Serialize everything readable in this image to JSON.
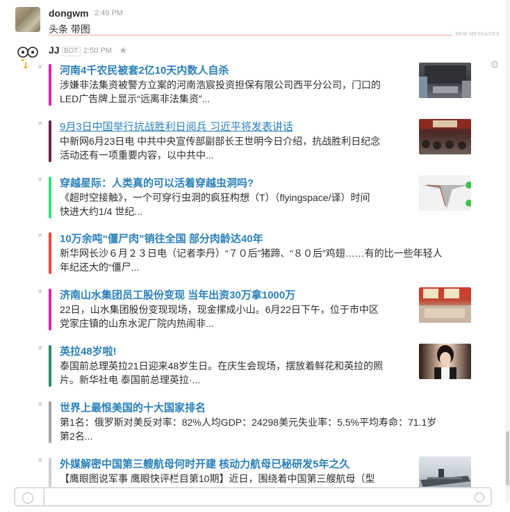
{
  "message1": {
    "username": "dongwm",
    "time": "2:49 PM",
    "text": "头条 带图"
  },
  "divider": {
    "label": "NEW MESSAGES"
  },
  "message2": {
    "username": "JJ",
    "badge": "BOT",
    "time": "2:50 PM"
  },
  "attachments": [
    {
      "title": "河南4千农民被套2亿10天内数人自杀",
      "desc_line1": "涉嫌非法集资被警方立案的河南浩宸投资担保有限公司西平分公司，门口的",
      "desc_line2": "LED广告牌上显示“远离非法集资”...",
      "bar_color": "#e01fb4",
      "has_thumb": true
    },
    {
      "title": "9月3日中国举行抗战胜利日阅兵 习近平将发表讲话",
      "desc_line1": "中新网6月23日电 中共中央宣传部副部长王世明今日介绍，抗战胜利日纪念",
      "desc_line2": "活动还有一项重要内容，以中共中...",
      "bar_color": "#6b2149",
      "has_thumb": true
    },
    {
      "title": "穿越星际：人类真的可以活着穿越虫洞吗?",
      "desc_line1": "《超时空接触》，一个可穿行虫洞的疯狂构想（T）（flyingspace/译）时间",
      "desc_line2": "快进大约1/4 世纪...",
      "bar_color": "#2ee57e",
      "has_thumb": true
    },
    {
      "title": "10万余吨“僵尸肉”销往全国 部分肉龄达40年",
      "desc_line1": "新华网长沙６月２３日电（记者李丹）“７０后”猪蹄、“８０后”鸡翅……有的比一些年轻人",
      "desc_line2": "年纪还大的“僵尸...",
      "bar_color": "#f5443a",
      "has_thumb": false
    },
    {
      "title": "济南山水集团员工股份变现 当年出资30万拿1000万",
      "desc_line1": "22日，山水集团股份变现现场，现金摞成小山。6月22日下午，位于市中区",
      "desc_line2": "党家庄镇的山东水泥厂院内热闹非...",
      "bar_color": "#e01fb4",
      "has_thumb": true
    },
    {
      "title": "英拉48岁啦!",
      "desc_line1": "泰国前总理英拉21日迎来48岁生日。在庆生会现场，摆放着鲜花和英拉的照",
      "desc_line2": "片。新华社电 泰国前总理英拉·...",
      "bar_color": "#2c8b6b",
      "has_thumb": true
    },
    {
      "title": "世界上最恨美国的十大国家排名",
      "desc_line1": "第1名：俄罗斯对美反对率：82%人均GDP：24298美元失业率：5.5%平均寿命：71.1岁",
      "desc_line2": "第2名...",
      "bar_color": "#a3a3a3",
      "has_thumb": false
    },
    {
      "title": "外媒解密中国第三艘航母何时开建 核动力航母已秘研发5年之久",
      "desc_line1": "【鹰眼图说军事  鹰眼快评栏目第10期】近日，围绕着中国第三艘航母（型",
      "desc_line2": "",
      "bar_color": "#cfcfd2",
      "has_thumb": true
    }
  ],
  "icons": {
    "close": "close-icon",
    "star": "star-icon",
    "gear": "gear-icon",
    "plus": "plus-icon",
    "emoji": "emoji-icon"
  }
}
